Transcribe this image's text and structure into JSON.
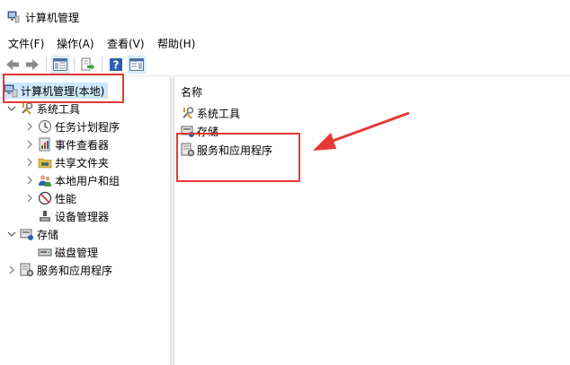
{
  "window": {
    "title": "计算机管理",
    "icon": "computer-management-icon"
  },
  "menu": [
    {
      "label": "文件(F)"
    },
    {
      "label": "操作(A)"
    },
    {
      "label": "查看(V)"
    },
    {
      "label": "帮助(H)"
    }
  ],
  "toolbar": {
    "icons": [
      "back-arrow-icon",
      "forward-arrow-icon",
      "show-hide-tree-icon",
      "export-list-icon",
      "help-icon",
      "properties-pane-icon"
    ]
  },
  "tree": {
    "root": {
      "label": "计算机管理(本地)",
      "icon": "computer-management-icon"
    },
    "system_tools": {
      "label": "系统工具",
      "icon": "tools-icon",
      "children": [
        {
          "label": "任务计划程序",
          "icon": "clock-icon"
        },
        {
          "label": "事件查看器",
          "icon": "event-viewer-icon"
        },
        {
          "label": "共享文件夹",
          "icon": "shared-folder-icon"
        },
        {
          "label": "本地用户和组",
          "icon": "users-icon"
        },
        {
          "label": "性能",
          "icon": "performance-icon"
        },
        {
          "label": "设备管理器",
          "icon": "device-manager-icon"
        }
      ]
    },
    "storage": {
      "label": "存储",
      "icon": "storage-icon",
      "children": [
        {
          "label": "磁盘管理",
          "icon": "disk-icon"
        }
      ]
    },
    "services": {
      "label": "服务和应用程序",
      "icon": "services-icon"
    }
  },
  "list": {
    "column_header": "名称",
    "items": [
      {
        "label": "系统工具",
        "icon": "tools-icon"
      },
      {
        "label": "存储",
        "icon": "storage-icon"
      },
      {
        "label": "服务和应用程序",
        "icon": "services-icon"
      }
    ]
  },
  "annotation": {
    "color": "#e53935"
  }
}
